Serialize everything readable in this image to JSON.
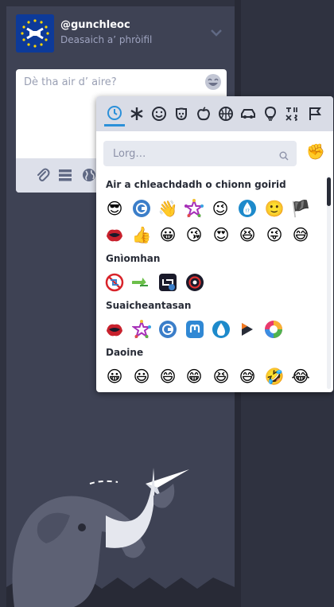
{
  "account": {
    "handle": "@gunchleoc",
    "edit_profile": "Deasaich a’ phròifil"
  },
  "composer": {
    "placeholder": "Dè tha air d’ aire?",
    "tools": [
      "paperclip-icon",
      "poll-icon",
      "globe-icon"
    ]
  },
  "picker": {
    "tabs": [
      "clock-icon",
      "asterisk-icon",
      "smiley-icon",
      "dog-icon",
      "apple-icon",
      "basketball-icon",
      "car-icon",
      "bulb-icon",
      "symbols-icon",
      "flag-icon"
    ],
    "search_placeholder": "Lorg…",
    "skin_tone": "✊",
    "categories": {
      "recent": "Air a chleachdadh o chionn goirid",
      "activity": "Gnìomhan",
      "brands": "Suaicheantasan",
      "people": "Daoine"
    },
    "recent_row1": [
      "😎",
      "",
      "👋",
      "",
      "😉",
      "",
      "🙂",
      "🏴"
    ],
    "recent_row2": [
      "",
      "👍",
      "😀",
      "😘",
      "😍",
      "😆",
      "😜",
      "😅"
    ],
    "people_row": [
      "😀",
      "😃",
      "😄",
      "😁",
      "😆",
      "😅",
      "🤣",
      "😂"
    ]
  },
  "colors": {
    "accent": "#2b90d9",
    "column": "#3e4254",
    "background": "#2f3240"
  }
}
